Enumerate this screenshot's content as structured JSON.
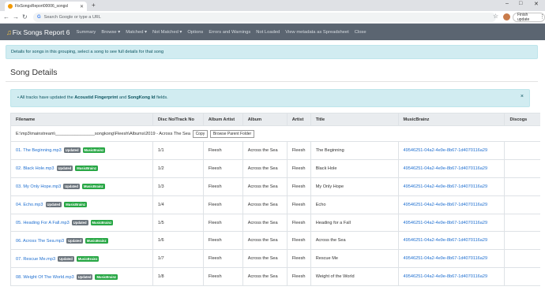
{
  "browser": {
    "tab_title": "FixSongsReport00006_songsl",
    "new_tab": "+",
    "window_controls": [
      "–",
      "□",
      "✕"
    ],
    "omnibox_placeholder": "Search Google or type a URL",
    "finish_update": "Finish update",
    "icons": [
      "back-arrow-icon",
      "forward-arrow-icon",
      "reload-icon",
      "google-g-icon",
      "star-icon",
      "avatar-icon",
      "kebab-menu-icon"
    ]
  },
  "nav": {
    "brand": "Fix Songs Report 6",
    "items": [
      "Summary",
      "Browse ▾",
      "Matched ▾",
      "Not Matched ▾",
      "Options",
      "Errors and Warnings",
      "Not Loaded",
      "View metadata as Spreadsheet",
      "Close"
    ]
  },
  "info_text": "Details for songs in this grouping, select a song to see full details for that song",
  "page_title": "Song Details",
  "alert": {
    "prefix": "All tracks have updated the",
    "field1": "Acoustid Fingerprint",
    "joiner": "and",
    "field2": "SongKong Id",
    "suffix": "fields.",
    "close": "×"
  },
  "table": {
    "headers": [
      "Filename",
      "Disc No/Track No",
      "Album Artist",
      "Album",
      "Artist",
      "Title",
      "MusicBrainz",
      "Discogs"
    ],
    "path": "E:\\mp3\\mainstream\\________________songkong\\Fleesh\\Albums\\2019 - Across The Sea",
    "copy_button": "Copy",
    "browse_button": "Browse Parent Folder",
    "badge_updated": "Updated",
    "badge_musicbrainz": "MusicBrainz",
    "rows": [
      {
        "file": "01. The Beginning.mp3",
        "track": "1/1",
        "album_artist": "Fleesh",
        "album": "Across the Sea",
        "artist": "Fleesh",
        "title": "The Beginning",
        "mb": "49546251-04a2-4e9e-8b67-1d4070116a29"
      },
      {
        "file": "02. Black Hole.mp3",
        "track": "1/2",
        "album_artist": "Fleesh",
        "album": "Across the Sea",
        "artist": "Fleesh",
        "title": "Black Hole",
        "mb": "49546251-04a2-4e9e-8b67-1d4070116a29"
      },
      {
        "file": "03. My Only Hope.mp3",
        "track": "1/3",
        "album_artist": "Fleesh",
        "album": "Across the Sea",
        "artist": "Fleesh",
        "title": "My Only Hope",
        "mb": "49546251-04a2-4e9e-8b67-1d4070116a29"
      },
      {
        "file": "04. Echo.mp3",
        "track": "1/4",
        "album_artist": "Fleesh",
        "album": "Across the Sea",
        "artist": "Fleesh",
        "title": "Echo",
        "mb": "49546251-04a2-4e9e-8b67-1d4070116a29"
      },
      {
        "file": "05. Heading For A Fall.mp3",
        "track": "1/5",
        "album_artist": "Fleesh",
        "album": "Across the Sea",
        "artist": "Fleesh",
        "title": "Heading for a Fall",
        "mb": "49546251-04a2-4e9e-8b67-1d4070116a29"
      },
      {
        "file": "06. Across The Sea.mp3",
        "track": "1/6",
        "album_artist": "Fleesh",
        "album": "Across the Sea",
        "artist": "Fleesh",
        "title": "Across the Sea",
        "mb": "49546251-04a2-4e9e-8b67-1d4070116a29"
      },
      {
        "file": "07. Rescue Me.mp3",
        "track": "1/7",
        "album_artist": "Fleesh",
        "album": "Across the Sea",
        "artist": "Fleesh",
        "title": "Rescue Me",
        "mb": "49546251-04a2-4e9e-8b67-1d4070116a29"
      },
      {
        "file": "08. Weight Of The World.mp3",
        "track": "1/8",
        "album_artist": "Fleesh",
        "album": "Across the Sea",
        "artist": "Fleesh",
        "title": "Weight of the World",
        "mb": "49546251-04a2-4e9e-8b67-1d4070116a29"
      }
    ]
  },
  "colors": {
    "navbar": "#5b6571",
    "info_bg": "#d1ecf1",
    "link": "#1f6fd0",
    "badge_updated": "#6c757d",
    "badge_musicbrainz": "#28a745"
  }
}
